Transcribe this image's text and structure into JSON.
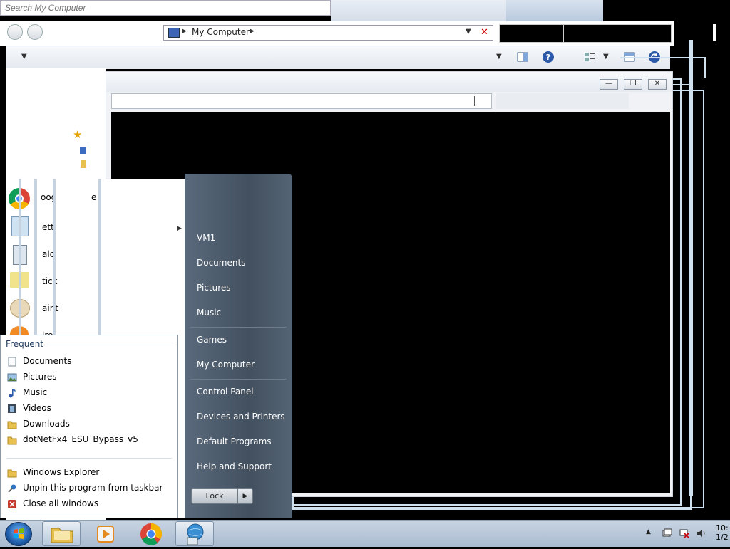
{
  "explorer": {
    "search_placeholder": "Search My Computer",
    "address_path": "My Computer"
  },
  "start_menu": {
    "right_items": [
      "VM1",
      "Documents",
      "Pictures",
      "Music",
      "Games",
      "My Computer",
      "Control Panel",
      "Devices and Printers",
      "Default Programs",
      "Help and Support"
    ],
    "shutdown_label": "Lock"
  },
  "jumplist": {
    "heading": "Frequent",
    "frequent": [
      "Documents",
      "Pictures",
      "Music",
      "Videos",
      "Downloads",
      "dotNetFx4_ESU_Bypass_v5"
    ],
    "tasks": [
      "Windows Explorer",
      "Unpin this program from taskbar",
      "Close all windows"
    ]
  },
  "taskbar": {
    "clock_time": "10:",
    "clock_date": "1/2"
  },
  "colors": {
    "start_menu_right": "#4a5868",
    "jumplist_heading": "#1e395b",
    "taskbar": "#b5c5d8"
  }
}
